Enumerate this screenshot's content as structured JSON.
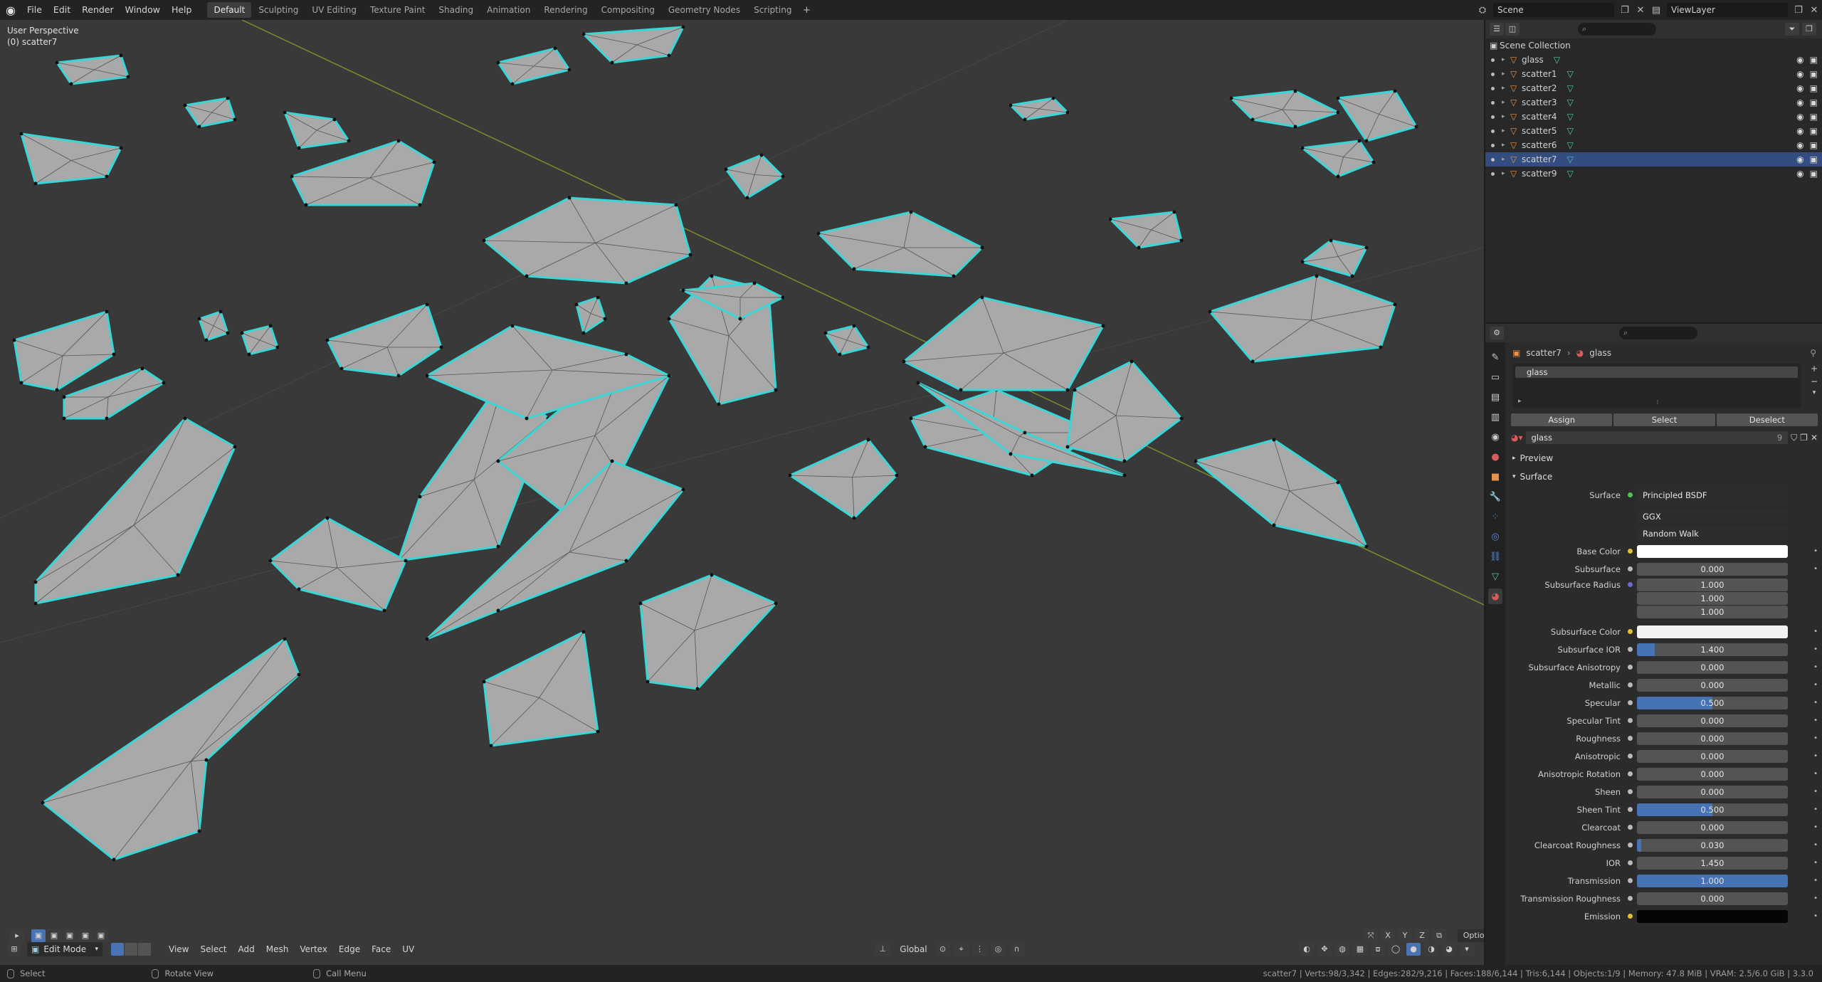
{
  "menu": [
    "File",
    "Edit",
    "Render",
    "Window",
    "Help"
  ],
  "workspaces": [
    "Default",
    "Sculpting",
    "UV Editing",
    "Texture Paint",
    "Shading",
    "Animation",
    "Rendering",
    "Compositing",
    "Geometry Nodes",
    "Scripting"
  ],
  "active_workspace": "Default",
  "scene_name": "Scene",
  "view_layer": "ViewLayer",
  "viewport": {
    "view_name": "User Perspective",
    "object_label": "(0) scatter7",
    "mode": "Edit Mode",
    "menus": [
      "View",
      "Select",
      "Add",
      "Mesh",
      "Vertex",
      "Edge",
      "Face",
      "UV"
    ],
    "orientation": "Global",
    "axes": [
      "X",
      "Y",
      "Z"
    ],
    "options_label": "Options"
  },
  "outliner": {
    "root": "Scene Collection",
    "objects": [
      "glass",
      "scatter1",
      "scatter2",
      "scatter3",
      "scatter4",
      "scatter5",
      "scatter6",
      "scatter7",
      "scatter9"
    ],
    "selected": "scatter7"
  },
  "properties": {
    "breadcrumb_object": "scatter7",
    "breadcrumb_material": "glass",
    "slot": "glass",
    "buttons": {
      "assign": "Assign",
      "select": "Select",
      "deselect": "Deselect"
    },
    "material_name": "glass",
    "user_count": "9",
    "sections": {
      "preview": "Preview",
      "surface": "Surface"
    },
    "surface_label": "Surface",
    "surface_shader": "Principled BSDF",
    "distribution": "GGX",
    "subsurface_method": "Random Walk",
    "rows": [
      {
        "label": "Base Color",
        "kind": "color",
        "color": "#ffffff",
        "dot": "#e0c030"
      },
      {
        "label": "Subsurface",
        "kind": "num",
        "value": "0.000",
        "fill": 0
      },
      {
        "label": "Subsurface Radius",
        "kind": "vec",
        "values": [
          "1.000",
          "1.000",
          "1.000"
        ],
        "dot": "#6b6bd6"
      },
      {
        "label": "Subsurface Color",
        "kind": "color",
        "color": "#f2f2f2",
        "dot": "#e0c030"
      },
      {
        "label": "Subsurface IOR",
        "kind": "num",
        "value": "1.400",
        "fill": 0.12
      },
      {
        "label": "Subsurface Anisotropy",
        "kind": "num",
        "value": "0.000",
        "fill": 0
      },
      {
        "label": "Metallic",
        "kind": "num",
        "value": "0.000",
        "fill": 0
      },
      {
        "label": "Specular",
        "kind": "num",
        "value": "0.500",
        "fill": 0.5
      },
      {
        "label": "Specular Tint",
        "kind": "num",
        "value": "0.000",
        "fill": 0
      },
      {
        "label": "Roughness",
        "kind": "num",
        "value": "0.000",
        "fill": 0
      },
      {
        "label": "Anisotropic",
        "kind": "num",
        "value": "0.000",
        "fill": 0
      },
      {
        "label": "Anisotropic Rotation",
        "kind": "num",
        "value": "0.000",
        "fill": 0
      },
      {
        "label": "Sheen",
        "kind": "num",
        "value": "0.000",
        "fill": 0
      },
      {
        "label": "Sheen Tint",
        "kind": "num",
        "value": "0.500",
        "fill": 0.5
      },
      {
        "label": "Clearcoat",
        "kind": "num",
        "value": "0.000",
        "fill": 0
      },
      {
        "label": "Clearcoat Roughness",
        "kind": "num",
        "value": "0.030",
        "fill": 0.03
      },
      {
        "label": "IOR",
        "kind": "num",
        "value": "1.450",
        "fill": 0
      },
      {
        "label": "Transmission",
        "kind": "num",
        "value": "1.000",
        "fill": 1
      },
      {
        "label": "Transmission Roughness",
        "kind": "num",
        "value": "0.000",
        "fill": 0
      },
      {
        "label": "Emission",
        "kind": "color",
        "color": "#050505",
        "dot": "#e0c030"
      }
    ]
  },
  "status": {
    "select": "Select",
    "rotate": "Rotate View",
    "call_menu": "Call Menu",
    "stats": "scatter7 | Verts:98/3,342 | Edges:282/9,216 | Faces:188/6,144 | Tris:6,144 | Objects:1/9 | Memory: 47.8 MiB | VRAM: 2.5/6.0 GiB | 3.3.0"
  },
  "colors": {
    "accent": "#4772b3",
    "mesh_edge": "#3ad6d6",
    "mesh_face": "#a9a9a9",
    "selected_row": "#334d80"
  }
}
